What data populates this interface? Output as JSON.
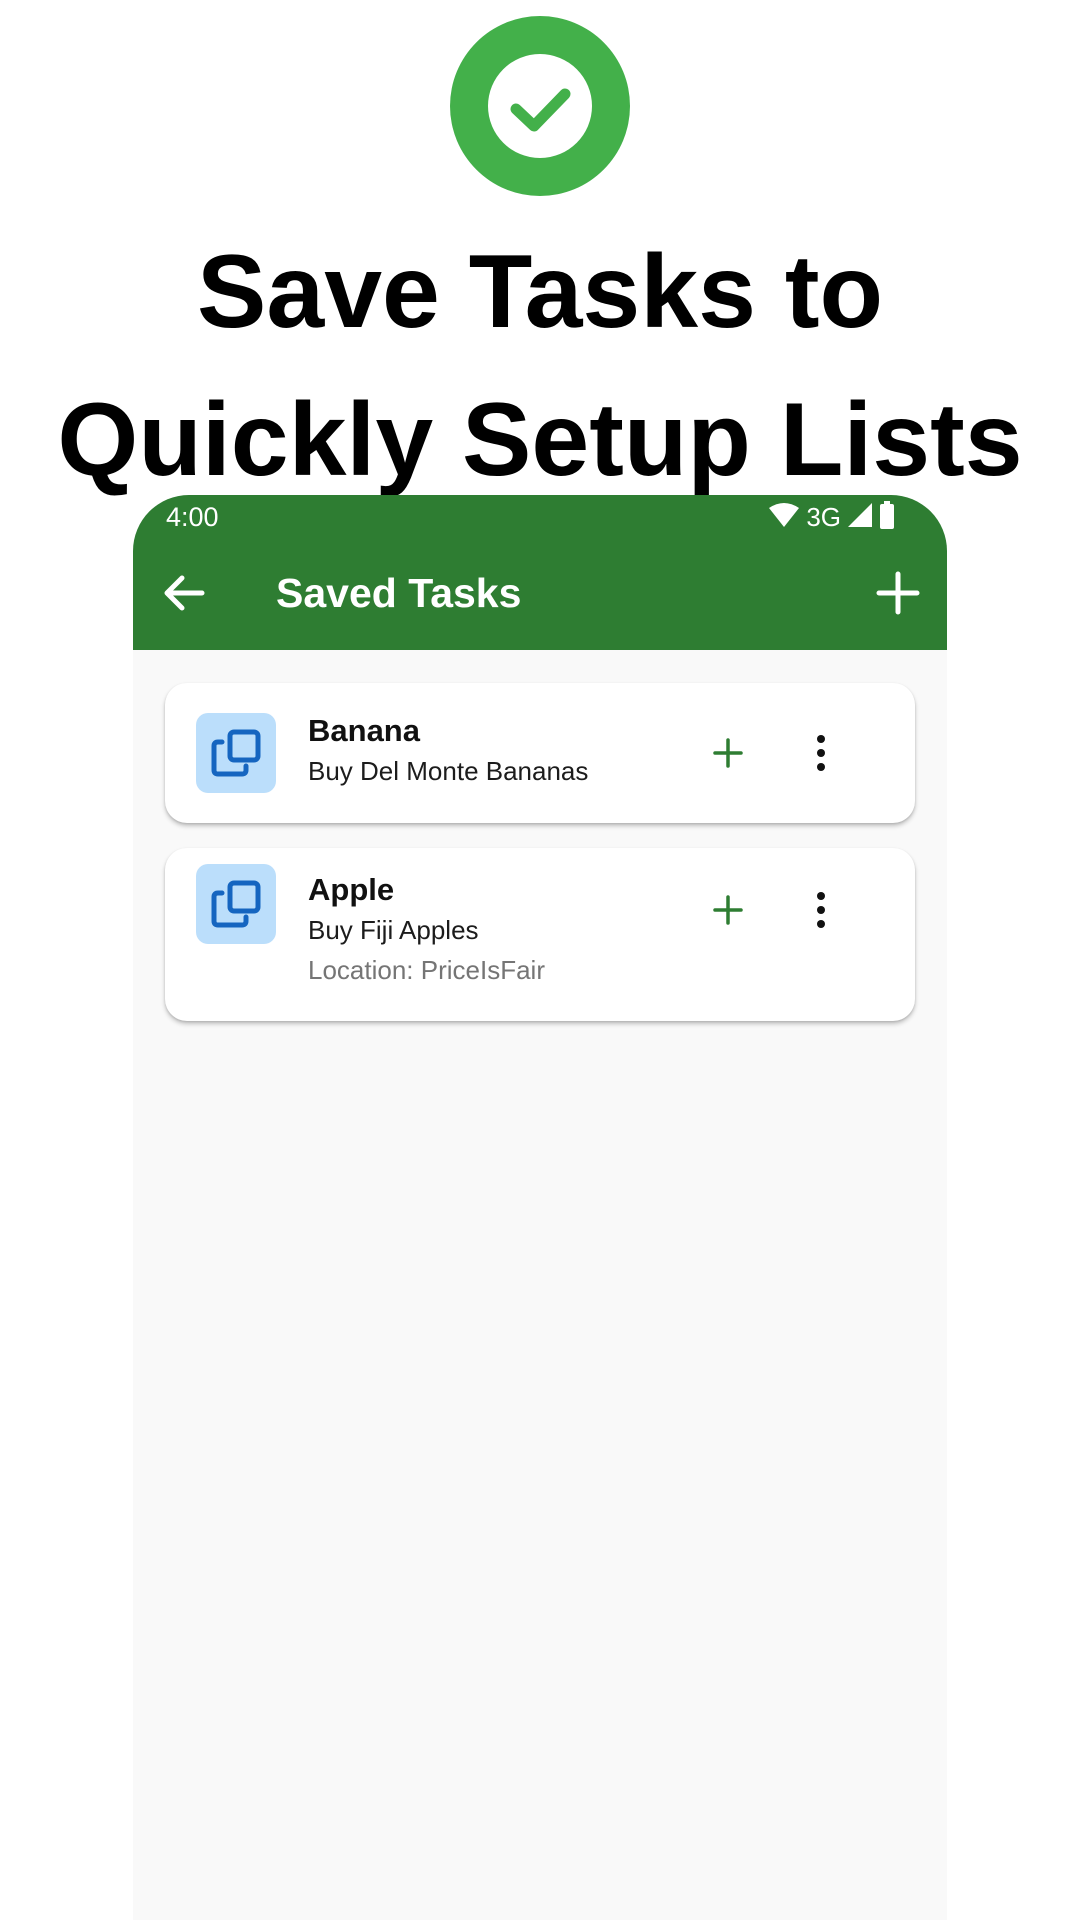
{
  "promo": {
    "icon": "check-circle-icon",
    "headline": "Save Tasks to Quickly Setup Lists",
    "accent_color": "#43b04a"
  },
  "status_bar": {
    "time": "4:00",
    "network": "3G",
    "icons": [
      "wifi-icon",
      "signal-icon",
      "battery-icon"
    ]
  },
  "app_bar": {
    "title": "Saved Tasks",
    "back_icon": "arrow-back-icon",
    "add_icon": "add-icon",
    "color": "#2e7d32"
  },
  "saved_tasks": [
    {
      "title": "Banana",
      "description": "Buy Del Monte Bananas",
      "icon": "copy-icon",
      "add_icon": "add-icon",
      "menu_icon": "more-vert-icon"
    },
    {
      "title": "Apple",
      "description": "Buy Fiji Apples",
      "location": "Location: PriceIsFair",
      "icon": "copy-icon",
      "add_icon": "add-icon",
      "menu_icon": "more-vert-icon"
    }
  ],
  "colors": {
    "thumb_bg": "#bbdefb",
    "thumb_icon": "#1565c0",
    "card_add": "#2e7d32",
    "list_bg": "#f9f9f9"
  }
}
